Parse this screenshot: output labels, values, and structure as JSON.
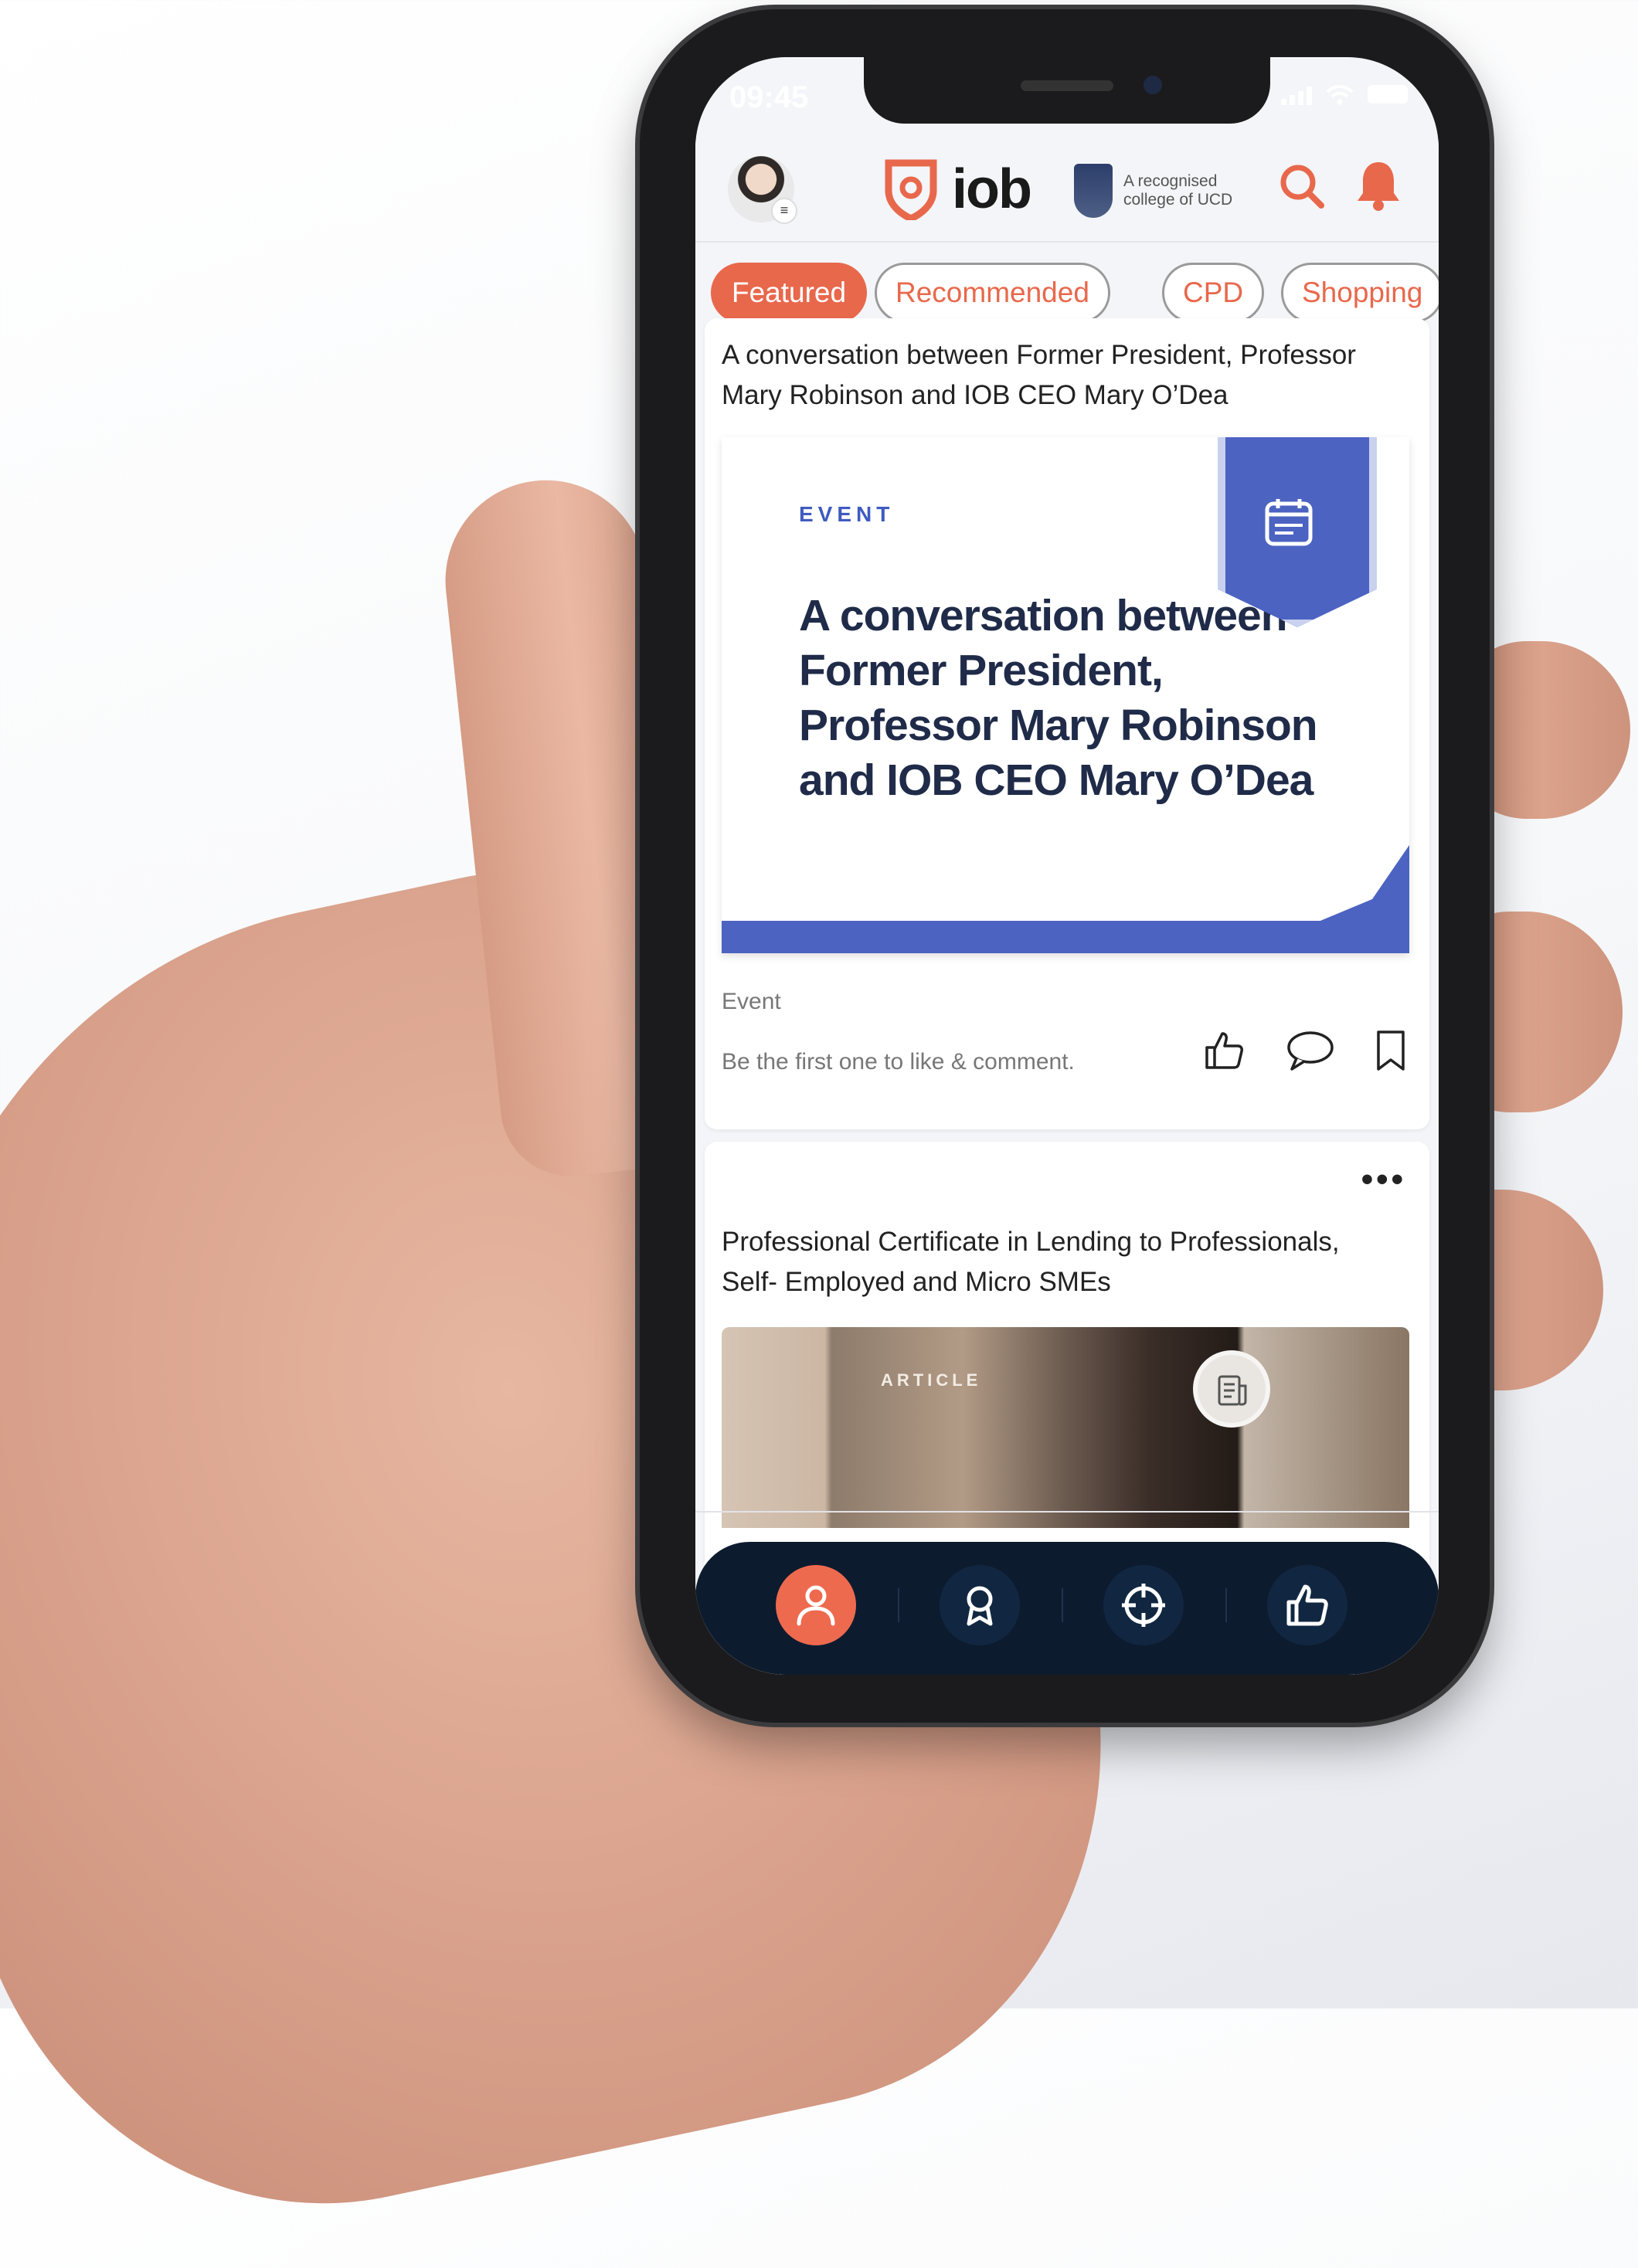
{
  "status_bar": {
    "time": "09:45"
  },
  "header": {
    "brand": "iob",
    "ucd_tagline_line1": "A recognised",
    "ucd_tagline_line2": "college of UCD",
    "search_icon": "search-icon",
    "bell_icon": "bell-icon"
  },
  "tabs": [
    {
      "label": "Featured",
      "active": true
    },
    {
      "label": "Recommended",
      "active": false
    },
    {
      "label": "CPD",
      "active": false
    },
    {
      "label": "Shopping",
      "active": false
    }
  ],
  "feed": {
    "card1": {
      "title": "A conversation between Former President, Professor Mary Robinson and IOB CEO Mary O’Dea",
      "image_kicker": "EVENT",
      "image_headline": "A conversation between Former President, Professor Mary Robinson and IOB CEO Mary O’Dea",
      "category": "Event",
      "engagement_prompt": "Be the first one to like & comment.",
      "icons": [
        "thumbs-up-icon",
        "comment-icon",
        "bookmark-icon"
      ]
    },
    "card2": {
      "title": "Professional Certificate in Lending to Professionals, Self- Employed and Micro SMEs",
      "image_kicker": "ARTICLE",
      "more_icon": "more-icon"
    }
  },
  "bottom_nav": {
    "items": [
      "profile-icon",
      "award-icon",
      "target-icon",
      "thumbs-up-icon"
    ],
    "active_index": 0
  },
  "colors": {
    "accent": "#e8684c",
    "nav_bg": "#0d1b2e",
    "event_blue": "#4c63c2"
  }
}
